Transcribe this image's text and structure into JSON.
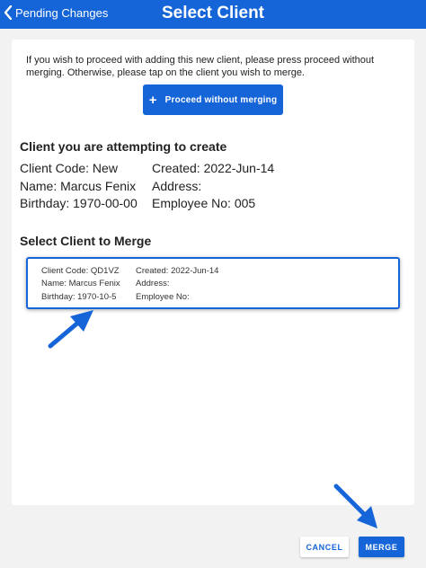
{
  "nav": {
    "back_label": "Pending Changes",
    "title": "Select Client"
  },
  "intro": {
    "text": "If you wish to proceed with adding this new client, please press proceed without merging. Otherwise, please tap on the client you wish to merge.",
    "proceed_label": "Proceed without merging"
  },
  "create": {
    "heading": "Client you are attempting to create",
    "client_code": "Client Code: New",
    "created": "Created: 2022-Jun-14",
    "name": "Name: Marcus Fenix",
    "address": "Address:",
    "birthday": "Birthday: 1970-00-00",
    "employee_no": "Employee No: 005"
  },
  "merge": {
    "heading": "Select Client to Merge",
    "candidate": {
      "client_code": "Client Code: QD1VZ",
      "created": "Created: 2022-Jun-14",
      "name": "Name: Marcus Fenix",
      "address": "Address:",
      "birthday": "Birthday: 1970-10-5",
      "employee_no": "Employee No:"
    }
  },
  "footer": {
    "cancel_label": "CANCEL",
    "merge_label": "MERGE"
  },
  "colors": {
    "accent": "#1565d8",
    "background": "#f2f2f2"
  },
  "icons": {
    "back": "chevron-left-icon",
    "plus": "plus-icon",
    "annotation": "pointer-arrow-icon"
  }
}
